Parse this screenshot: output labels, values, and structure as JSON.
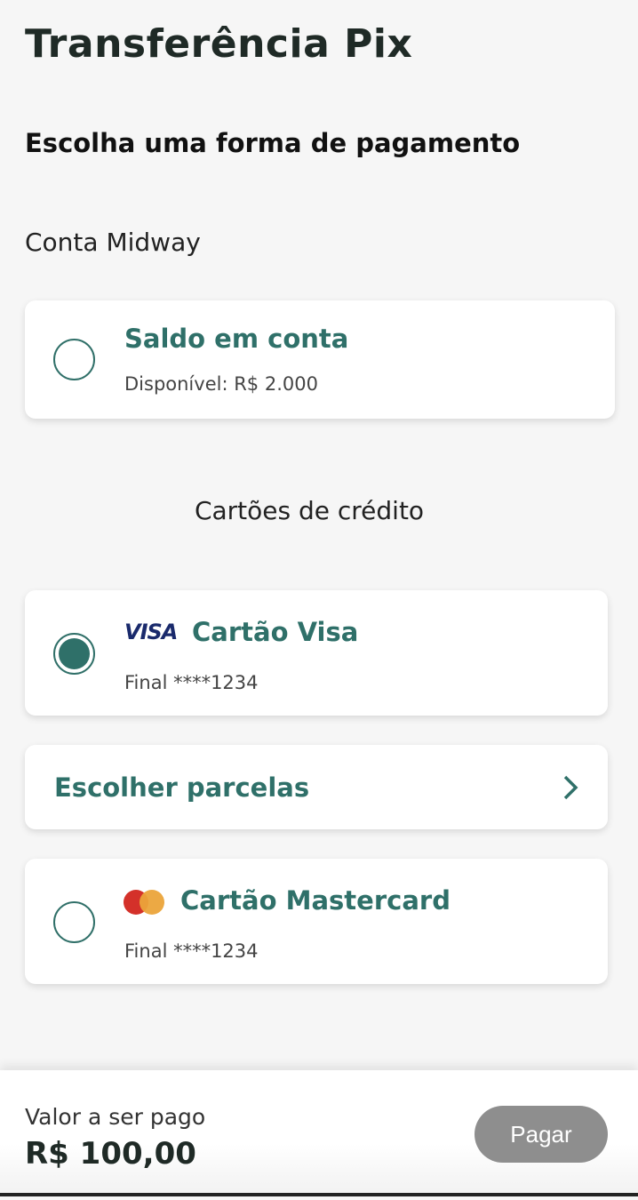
{
  "header": {
    "title": "Transferência Pix",
    "subtitle": "Escolha uma forma de pagamento"
  },
  "account_section": {
    "title": "Conta Midway",
    "option": {
      "title": "Saldo em conta",
      "subtitle": "Disponível: R$ 2.000",
      "selected": false
    }
  },
  "cards_section": {
    "title": "Cartões de crédito",
    "cards": [
      {
        "brand": "VISA",
        "title": "Cartão Visa",
        "subtitle": "Final ****1234",
        "selected": true
      },
      {
        "brand": "mastercard",
        "title": "Cartão Mastercard",
        "subtitle": "Final ****1234",
        "selected": false
      }
    ],
    "installments_label": "Escolher parcelas"
  },
  "footer": {
    "amount_label": "Valor a ser pago",
    "amount": "R$ 100,00",
    "pay_label": "Pagar"
  },
  "colors": {
    "accent": "#2f7069",
    "button_disabled": "#8e8e8e"
  }
}
